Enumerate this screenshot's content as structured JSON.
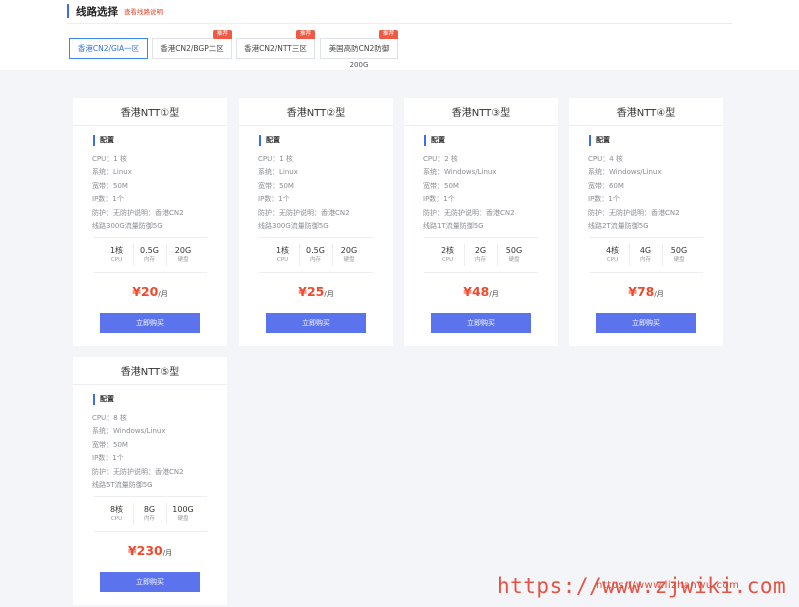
{
  "section": {
    "title": "线路选择",
    "link": "查看线路说明"
  },
  "tabs": [
    {
      "label": "香港CN2/GIA一区",
      "badge": "",
      "active": true
    },
    {
      "label": "香港CN2/BGP二区",
      "badge": "推荐",
      "active": false
    },
    {
      "label": "香港CN2/NTT三区",
      "badge": "推荐",
      "active": false
    },
    {
      "label": "美国高防CN2防御",
      "badge": "推荐",
      "active": false
    }
  ],
  "tab4_subtitle": "200G",
  "config_label": "配置",
  "buy_label": "立即购买",
  "price_unit": "/月",
  "cards": [
    {
      "name": "香港NTT①型",
      "info": [
        "CPU：1 核",
        "系统：Linux",
        "宽带：50M",
        "IP数：1个",
        "防护：无防护说明：香港CN2",
        "线路300G流量防御5G"
      ],
      "specs": [
        {
          "v": "1核",
          "l": "CPU"
        },
        {
          "v": "0.5G",
          "l": "内存"
        },
        {
          "v": "20G",
          "l": "硬盘"
        }
      ],
      "price": "¥20"
    },
    {
      "name": "香港NTT②型",
      "info": [
        "CPU：1 核",
        "系统：Linux",
        "宽带：50M",
        "IP数：1个",
        "防护：无防护说明：香港CN2",
        "线路300G流量防御5G"
      ],
      "specs": [
        {
          "v": "1核",
          "l": "CPU"
        },
        {
          "v": "0.5G",
          "l": "内存"
        },
        {
          "v": "20G",
          "l": "硬盘"
        }
      ],
      "price": "¥25"
    },
    {
      "name": "香港NTT③型",
      "info": [
        "CPU：2 核",
        "系统：Windows/Linux",
        "宽带：50M",
        "IP数：1个",
        "防护：无防护说明：香港CN2",
        "线路1T流量防御5G"
      ],
      "specs": [
        {
          "v": "2核",
          "l": "CPU"
        },
        {
          "v": "2G",
          "l": "内存"
        },
        {
          "v": "50G",
          "l": "硬盘"
        }
      ],
      "price": "¥48"
    },
    {
      "name": "香港NTT④型",
      "info": [
        "CPU：4 核",
        "系统：Windows/Linux",
        "宽带：60M",
        "IP数：1个",
        "防护：无防护说明：香港CN2",
        "线路2T流量防御5G"
      ],
      "specs": [
        {
          "v": "4核",
          "l": "CPU"
        },
        {
          "v": "4G",
          "l": "内存"
        },
        {
          "v": "50G",
          "l": "硬盘"
        }
      ],
      "price": "¥78"
    },
    {
      "name": "香港NTT⑤型",
      "info": [
        "CPU：8 核",
        "系统：Windows/Linux",
        "宽带：50M",
        "IP数：1个",
        "防护：无防护说明：香港CN2",
        "线路5T流量防御5G"
      ],
      "specs": [
        {
          "v": "8核",
          "l": "CPU"
        },
        {
          "v": "8G",
          "l": "内存"
        },
        {
          "v": "100G",
          "l": "硬盘"
        }
      ],
      "price": "¥230"
    }
  ],
  "watermark": {
    "small": "https://www.lizhanwu.com",
    "large": "https://www.zjwiki.com"
  },
  "colors": {
    "accent": "#3b6cf6",
    "price": "#f04a2e",
    "button": "#5b73ec",
    "badge": "#ef5a45"
  }
}
